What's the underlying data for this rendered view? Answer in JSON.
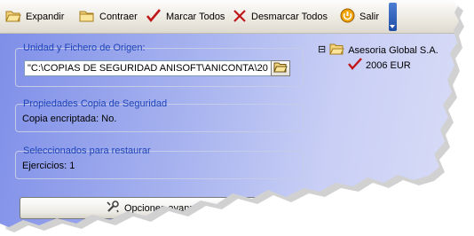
{
  "toolbar": {
    "expand_label": "Expandir",
    "collapse_label": "Contraer",
    "mark_all_label": "Marcar Todos",
    "unmark_all_label": "Desmarcar Todos",
    "exit_label": "Salir"
  },
  "origin_group": {
    "title": "Unidad y Fichero de Origen:",
    "path_value": "\"C:\\COPIAS DE SEGURIDAD ANISOFT\\ANICONTA\\20"
  },
  "backup_props": {
    "title": "Propiedades Copia de Seguridad",
    "encrypted_label": "Copia encriptada:",
    "encrypted_value": "No."
  },
  "restore_selected": {
    "title": "Seleccionados para restaurar",
    "exercises_label": "Ejercicios:",
    "exercises_value": "1"
  },
  "tree": {
    "root_expander": "⊟",
    "root_label": "Asesoria Global S.A.",
    "child_label": "2006 EUR"
  },
  "advanced_button_label": "Opciones avanza",
  "colors": {
    "group_title": "#1f44b8",
    "selection": "#316ac5",
    "check_red": "#c0161a",
    "panel_gradient_start": "#7f8fe8",
    "panel_gradient_end": "#d9ddf7"
  },
  "icons": {
    "expand": "folder-open-icon",
    "collapse": "folder-icon",
    "mark_all": "checkmark-icon",
    "unmark_all": "cross-icon",
    "exit": "exit-icon",
    "browse": "browse-folder-icon",
    "advanced": "tools-icon"
  }
}
